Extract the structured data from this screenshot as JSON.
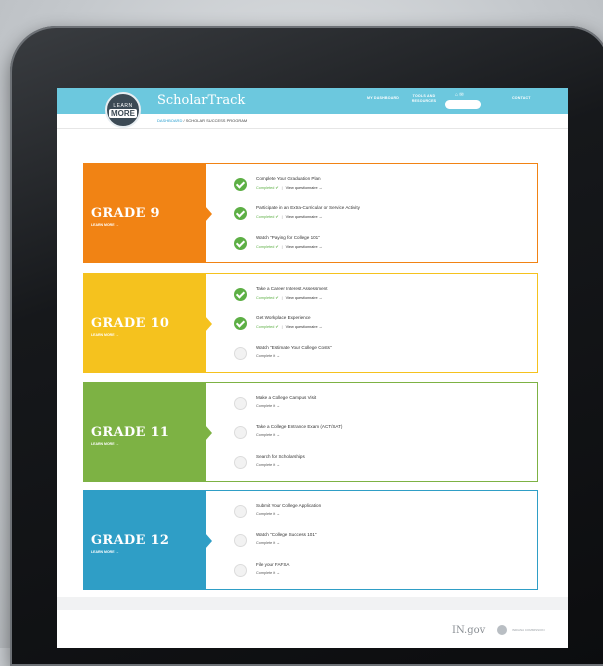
{
  "header": {
    "logo_line1": "LEARN",
    "logo_line2": "MORE",
    "brand": "ScholarTrack",
    "nav_dashboard": "MY DASHBOARD",
    "nav_tools": "TOOLS AND RESOURCES",
    "nav_contact": "CONTACT",
    "icons": "⌂ ✉"
  },
  "breadcrumb": {
    "root": "DASHBOARD",
    "sep": " / ",
    "current": "SCHOLAR SUCCESS PROGRAM"
  },
  "colors": {
    "grade9": "#f18314",
    "grade10": "#f5c21e",
    "grade11": "#7db244",
    "grade12": "#2f9ec6",
    "done": "#5daf45",
    "header": "#6cc8de"
  },
  "grades": [
    {
      "title": "GRADE 9",
      "learn_more": "LEARN MORE →",
      "tasks": [
        {
          "title": "Complete Your Graduation Plan",
          "status": "Completed ✔",
          "sep": "|",
          "link": "View questionnaire →",
          "done": true
        },
        {
          "title": "Participate in an Extra-Curricular or Service Activity",
          "status": "Completed ✔",
          "sep": "|",
          "link": "View questionnaire →",
          "done": true
        },
        {
          "title": "Watch \"Paying for College 101\"",
          "status": "Completed ✔",
          "sep": "|",
          "link": "View questionnaire →",
          "done": true
        }
      ]
    },
    {
      "title": "GRADE 10",
      "learn_more": "LEARN MORE →",
      "tasks": [
        {
          "title": "Take a Career Interest Assessment",
          "status": "Completed ✔",
          "sep": "|",
          "link": "View questionnaire →",
          "done": true
        },
        {
          "title": "Get Workplace Experience",
          "status": "Completed ✔",
          "sep": "|",
          "link": "View questionnaire →",
          "done": true
        },
        {
          "title": "Watch \"Estimate Your College Costs\"",
          "status": "Complete it →",
          "sep": "",
          "link": "",
          "done": false
        }
      ]
    },
    {
      "title": "GRADE 11",
      "learn_more": "LEARN MORE →",
      "tasks": [
        {
          "title": "Make a College Campus Visit",
          "status": "Complete it →",
          "sep": "",
          "link": "",
          "done": false
        },
        {
          "title": "Take a College Entrance Exam (ACT/SAT)",
          "status": "Complete it →",
          "sep": "",
          "link": "",
          "done": false
        },
        {
          "title": "Search for Scholarships",
          "status": "Complete it →",
          "sep": "",
          "link": "",
          "done": false
        }
      ]
    },
    {
      "title": "GRADE 12",
      "learn_more": "LEARN MORE →",
      "tasks": [
        {
          "title": "Submit Your College Application",
          "status": "Complete it →",
          "sep": "",
          "link": "",
          "done": false
        },
        {
          "title": "Watch \"College Success 101\"",
          "status": "Complete it →",
          "sep": "",
          "link": "",
          "done": false
        },
        {
          "title": "File your FAFSA",
          "status": "Complete it →",
          "sep": "",
          "link": "",
          "done": false
        }
      ]
    }
  ],
  "footer": {
    "logo1": "IN.gov",
    "logo2": "INDIANA COMMISSION"
  }
}
